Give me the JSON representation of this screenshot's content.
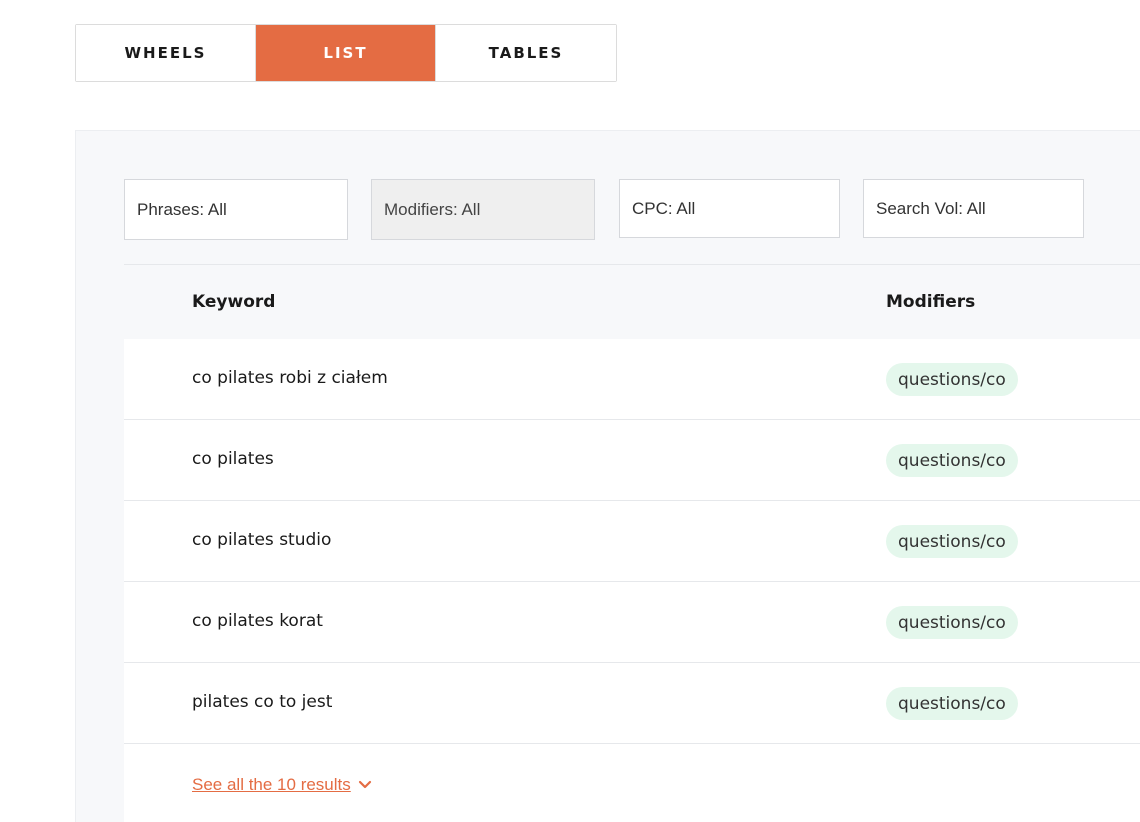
{
  "view_tabs": [
    {
      "label": "WHEELS",
      "active": false
    },
    {
      "label": "LIST",
      "active": true
    },
    {
      "label": "TABLES",
      "active": false
    }
  ],
  "filters": {
    "phrases": "Phrases: All",
    "modifiers": "Modifiers: All",
    "cpc": "CPC: All",
    "search_vol": "Search Vol: All"
  },
  "table": {
    "columns": {
      "keyword": "Keyword",
      "modifiers": "Modifiers"
    },
    "rows": [
      {
        "keyword": "co pilates robi z ciałem",
        "modifier": "questions/co"
      },
      {
        "keyword": "co pilates",
        "modifier": "questions/co"
      },
      {
        "keyword": "co pilates studio",
        "modifier": "questions/co"
      },
      {
        "keyword": "co pilates korat",
        "modifier": "questions/co"
      },
      {
        "keyword": "pilates co to jest",
        "modifier": "questions/co"
      }
    ]
  },
  "see_all": {
    "label": "See all the 10 results",
    "icon": "chevron-down-icon"
  },
  "colors": {
    "accent": "#e46c43",
    "badge_bg": "#e4f7ec",
    "panel_bg": "#f7f8fa"
  }
}
